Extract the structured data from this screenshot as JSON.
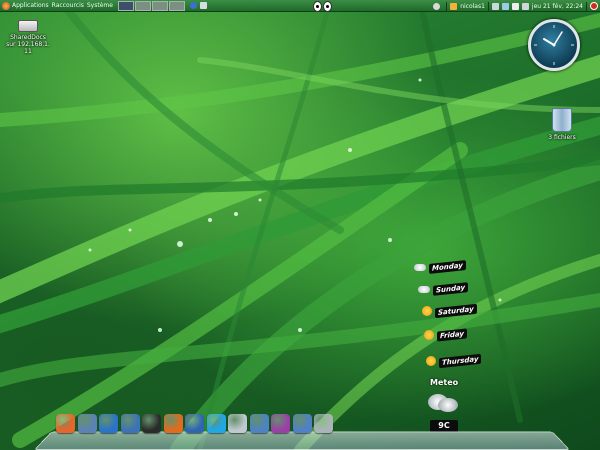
{
  "top_panel": {
    "menus": [
      {
        "label": "Applications"
      },
      {
        "label": "Raccourcis"
      },
      {
        "label": "Système"
      }
    ],
    "user": "nicolas1",
    "datetime": "jeu 21 fév, 22:24"
  },
  "desktop": {
    "shared_icon": {
      "label": "SharedDocs",
      "sublabel": "sur 192.168.1.",
      "sublabel2": "11"
    },
    "trash": {
      "label": "3 fichiers"
    }
  },
  "weather": {
    "title": "Meteo",
    "temperature": "9C",
    "days": [
      {
        "label": "Monday",
        "icon": "cloud-icon"
      },
      {
        "label": "Sunday",
        "icon": "cloud-icon"
      },
      {
        "label": "Saturday",
        "icon": "sun-icon"
      },
      {
        "label": "Friday",
        "icon": "sun-icon"
      },
      {
        "label": "Thursday",
        "icon": "sun-icon"
      }
    ]
  },
  "dock": {
    "icons": [
      {
        "name": "ubuntu-icon",
        "color": "#e8652b"
      },
      {
        "name": "home-icon",
        "color": "#5c82b5"
      },
      {
        "name": "computer-icon",
        "color": "#2a73c9"
      },
      {
        "name": "network-icon",
        "color": "#3d72b8"
      },
      {
        "name": "terminal-icon",
        "color": "#2b2b2b"
      },
      {
        "name": "firefox-icon",
        "color": "#e26b1e"
      },
      {
        "name": "thunderbird-icon",
        "color": "#2f64b3"
      },
      {
        "name": "skype-icon",
        "color": "#1fa7e8"
      },
      {
        "name": "text-editor-icon",
        "color": "#bfc9cf"
      },
      {
        "name": "folder-icon",
        "color": "#4d82c4"
      },
      {
        "name": "media-icon",
        "color": "#9b3fa8"
      },
      {
        "name": "home-folder-icon",
        "color": "#4f80c8"
      },
      {
        "name": "refresh-icon",
        "color": "#aab3b8"
      }
    ]
  }
}
